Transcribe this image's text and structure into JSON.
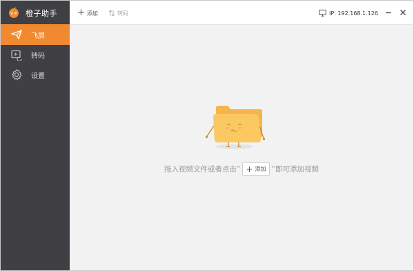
{
  "app": {
    "title": "橙子助手",
    "logo_text": "V·P"
  },
  "sidebar": {
    "items": [
      {
        "label": "飞屏",
        "icon": "paper-plane-icon",
        "active": true
      },
      {
        "label": "转码",
        "icon": "video-convert-icon",
        "active": false
      },
      {
        "label": "设置",
        "icon": "gear-icon",
        "active": false
      }
    ]
  },
  "toolbar": {
    "add_label": "添加",
    "transcode_label": "转码",
    "ip_text": "IP: 192.168.1.126"
  },
  "main": {
    "hint_before": "拖入视频文件或者点击”",
    "hint_button": "添加",
    "hint_after": "”即可添加视频"
  },
  "colors": {
    "accent": "#f0892f",
    "sidebar_bg": "#3f3f44",
    "folder": "#fcc862"
  }
}
